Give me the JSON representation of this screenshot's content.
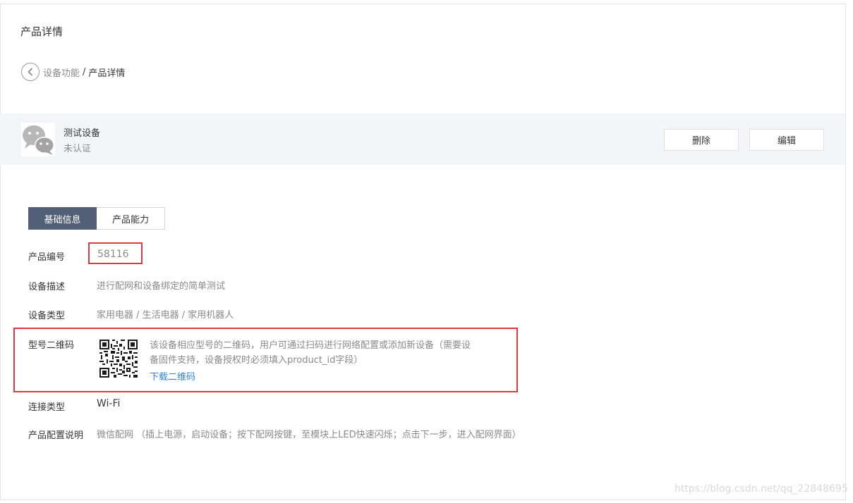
{
  "page": {
    "title": "产品详情"
  },
  "breadcrumb": {
    "parent": "设备功能",
    "separator": "/",
    "current": "产品详情"
  },
  "product": {
    "name": "测试设备",
    "status": "未认证"
  },
  "actions": {
    "delete_label": "删除",
    "edit_label": "编辑"
  },
  "tabs": [
    {
      "label": "基础信息",
      "active": true
    },
    {
      "label": "产品能力",
      "active": false
    }
  ],
  "info": {
    "product_id_label": "产品编号",
    "product_id_value": "58116",
    "description_label": "设备描述",
    "description_value": "进行配网和设备绑定的简单测试",
    "type_label": "设备类型",
    "type_value": "家用电器 / 生活电器 / 家用机器人",
    "qr_label": "型号二维码",
    "qr_desc_line1": "该设备相应型号的二维码，用户可通过扫码进行网络配置或添加新设备（需要设",
    "qr_desc_line2": "备固件支持，设备授权时必须填入product_id字段）",
    "qr_download": "下载二维码",
    "connection_label": "连接类型",
    "connection_value": "Wi-Fi",
    "config_label": "产品配置说明",
    "config_value": "微信配网 （插上电源，启动设备；按下配网按键，至模块上LED快速闪烁；点击下一步，进入配网界面）"
  },
  "watermark": "https://blog.csdn.net/qq_22848695",
  "colors": {
    "tab_active_bg": "#525f76",
    "highlight_border": "#e0383e",
    "link": "#2f86d6",
    "bar_bg": "#f4f5f9"
  }
}
